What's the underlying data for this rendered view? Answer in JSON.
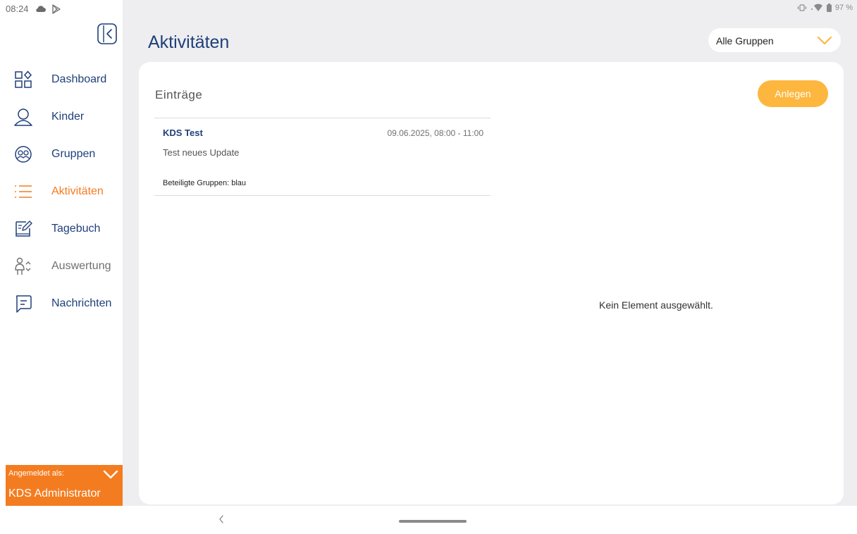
{
  "status_bar": {
    "time": "08:24",
    "battery": "97 %"
  },
  "sidebar": {
    "items": [
      {
        "label": "Dashboard",
        "icon": "dashboard-icon"
      },
      {
        "label": "Kinder",
        "icon": "person-icon"
      },
      {
        "label": "Gruppen",
        "icon": "group-icon"
      },
      {
        "label": "Aktivitäten",
        "icon": "list-icon",
        "active": true
      },
      {
        "label": "Tagebuch",
        "icon": "diary-icon"
      },
      {
        "label": "Auswertung",
        "icon": "evaluation-icon"
      },
      {
        "label": "Nachrichten",
        "icon": "message-icon"
      }
    ],
    "user": {
      "caption": "Angemeldet als:",
      "name": "KDS Administrator"
    }
  },
  "header": {
    "title": "Aktivitäten",
    "group_filter": "Alle Gruppen"
  },
  "main": {
    "entries_title": "Einträge",
    "add_label": "Anlegen",
    "entries": [
      {
        "title": "KDS Test",
        "date": "09.06.2025, 08:00 - 11:00",
        "description": "Test neues Update",
        "groups": "Beteiligte Gruppen: blau"
      }
    ],
    "empty_detail": "Kein Element ausgewählt."
  },
  "colors": {
    "accent_orange": "#f47c20",
    "button_orange": "#fdb73e",
    "primary_blue": "#1f3f7a",
    "background_gray": "#eeeef0"
  }
}
